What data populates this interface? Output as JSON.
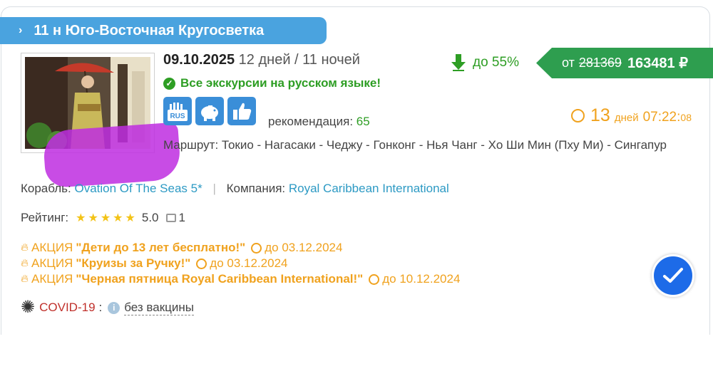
{
  "title": "11 н Юго-Восточная Кругосветка",
  "date": "09.10.2025",
  "duration": "12 дней / 11 ночей",
  "russian_excursions": "Все экскурсии на русском языке!",
  "feature_icons": [
    "rus-flag-icon",
    "piggy-bank-icon",
    "thumbs-up-icon"
  ],
  "recommendation_label": "рекомендация:",
  "recommendation_value": "65",
  "route_label": "Маршрут:",
  "route": "Токио - Нагасаки - Чеджу - Гонконг - Нья Чанг - Хо Ши Мин (Пху Ми) - Сингапур",
  "ship_label": "Корабль:",
  "ship": "Ovation Of The Seas 5*",
  "company_label": "Компания:",
  "company": "Royal Caribbean International",
  "rating_label": "Рейтинг:",
  "rating_stars": 5,
  "rating_value": "5.0",
  "comments_count": "1",
  "promos": [
    {
      "label": "АКЦИЯ",
      "name": "\"Дети до 13 лет бесплатно!\"",
      "until": "до 03.12.2024"
    },
    {
      "label": "АКЦИЯ",
      "name": "\"Круизы за Ручку!\"",
      "until": "до 03.12.2024"
    },
    {
      "label": "АКЦИЯ",
      "name": "\"Черная пятница Royal Caribbean International!\"",
      "until": "до 10.12.2024"
    }
  ],
  "covid_label": "COVID-19",
  "covid_sep": ":",
  "covid_value": "без вакцины",
  "discount": "до 55%",
  "price_from": "от",
  "price_old": "281369",
  "price_new": "163481 ₽",
  "timer_days": "13",
  "timer_days_label": "дней",
  "timer_hm": "07:22:",
  "timer_s": "08",
  "colors": {
    "accent": "#4aa3df",
    "green": "#2e9e24",
    "orange": "#f0a21e",
    "price_bg": "#2e9e4f",
    "check": "#1d6be8"
  }
}
